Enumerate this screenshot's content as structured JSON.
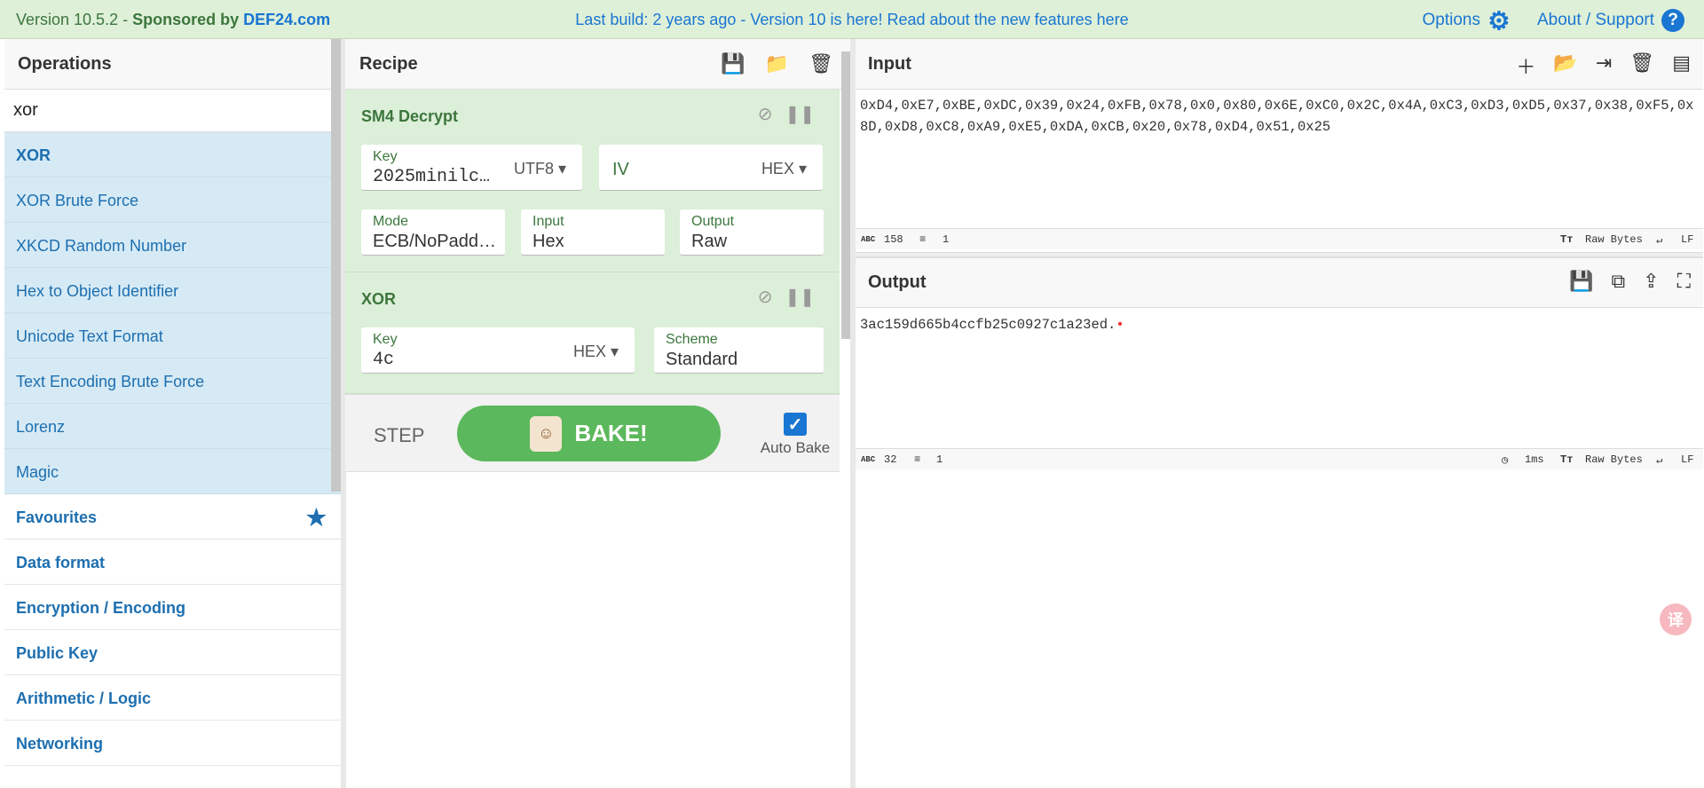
{
  "banner": {
    "version_prefix": "Version 10.5.2 - ",
    "sponsored": "Sponsored by",
    "sponsor": "DEF24.com",
    "notice": "Last build: 2 years ago - Version 10 is here! Read about the new features here",
    "options": "Options",
    "about": "About / Support"
  },
  "operations": {
    "title": "Operations",
    "search_value": "xor",
    "results": [
      "XOR",
      "XOR Brute Force",
      "XKCD Random Number",
      "Hex to Object Identifier",
      "Unicode Text Format",
      "Text Encoding Brute Force",
      "Lorenz",
      "Magic"
    ],
    "categories": [
      "Favourites",
      "Data format",
      "Encryption / Encoding",
      "Public Key",
      "Arithmetic / Logic",
      "Networking"
    ]
  },
  "recipe": {
    "title": "Recipe",
    "ops": [
      {
        "name": "SM4 Decrypt",
        "key_label": "Key",
        "key_value": "2025minilc…",
        "key_enc": "UTF8",
        "iv_label": "IV",
        "iv_enc": "HEX",
        "mode_label": "Mode",
        "mode_value": "ECB/NoPadd…",
        "input_label": "Input",
        "input_value": "Hex",
        "output_label": "Output",
        "output_value": "Raw"
      },
      {
        "name": "XOR",
        "key_label": "Key",
        "key_value": "4c",
        "key_enc": "HEX",
        "scheme_label": "Scheme",
        "scheme_value": "Standard"
      }
    ],
    "step": "STEP",
    "bake": "BAKE!",
    "auto_bake": "Auto Bake"
  },
  "input": {
    "title": "Input",
    "text": "0xD4,0xE7,0xBE,0xDC,0x39,0x24,0xFB,0x78,0x0,0x80,0x6E,0xC0,0x2C,0x4A,0xC3,0xD3,0xD5,0x37,0x38,0xF5,0x8D,0xD8,0xC8,0xA9,0xE5,0xDA,0xCB,0x20,0x78,0xD4,0x51,0x25",
    "abc_label": "ABC",
    "length": "158",
    "lines": "1",
    "encoding": "Raw Bytes",
    "eol": "LF"
  },
  "output": {
    "title": "Output",
    "text": "3ac159d665b4ccfb25c0927c1a23ed.",
    "abc_label": "ABC",
    "length": "32",
    "lines": "1",
    "time": "1ms",
    "encoding": "Raw Bytes",
    "eol": "LF"
  },
  "colors": {
    "banner_bg": "#dff0d8",
    "op_result_bg": "#d6eaf5",
    "recipe_op_bg": "#dcefd8",
    "bake_green": "#5cb85c",
    "link_blue": "#1976d2"
  }
}
